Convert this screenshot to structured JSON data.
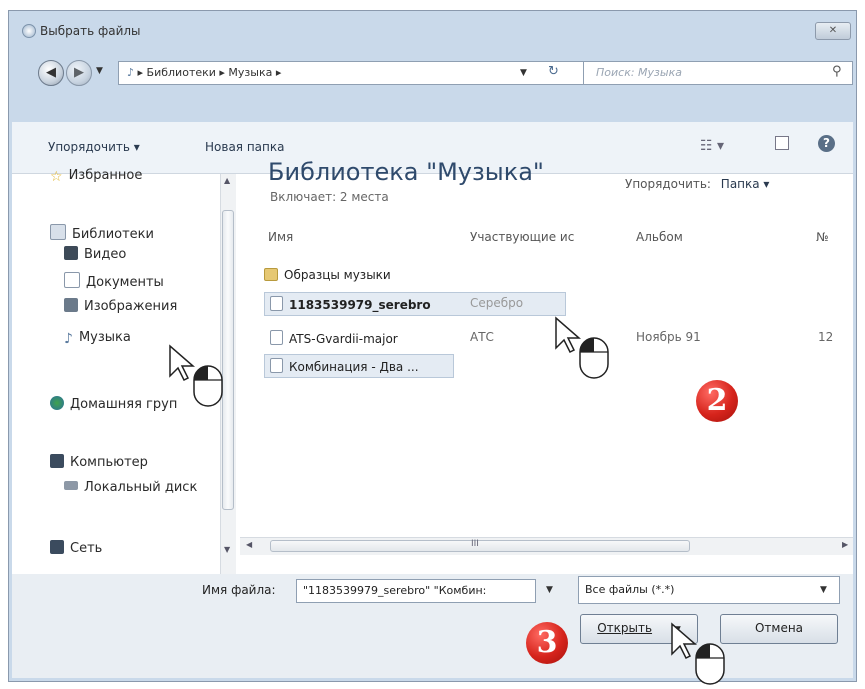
{
  "window": {
    "title": "Выбрать файлы",
    "close_icon": "close-icon"
  },
  "address": {
    "crumbs": "▸ Библиотеки ▸ Музыка ▸",
    "search_placeholder": "Поиск: Музыка"
  },
  "toolbar": {
    "organize": "Упорядочить ▾",
    "new_folder": "Новая папка"
  },
  "sidebar": {
    "favorites": "Избранное",
    "libraries": "Библиотеки",
    "video": "Видео",
    "documents": "Документы",
    "images": "Изображения",
    "music": "Музыка",
    "homegroup": "Домашняя груп",
    "computer": "Компьютер",
    "local_disk": "Локальный диск",
    "network": "Сеть"
  },
  "library": {
    "title": "Библиотека \"Музыка\"",
    "subtitle": "Включает: 2 места",
    "arrange_label": "Упорядочить:",
    "arrange_value": "Папка ▾"
  },
  "columns": {
    "name": "Имя",
    "artists": "Участвующие ис",
    "album": "Альбом",
    "number": "№"
  },
  "files": [
    {
      "name": "Образцы музыки",
      "artist": "",
      "album": "",
      "number": ""
    },
    {
      "name": "1183539979_serebro",
      "artist": "Серебро",
      "album": "",
      "number": ""
    },
    {
      "name": "ATS-Gvardii-major",
      "artist": "АТС",
      "album": "Ноябрь 91",
      "number": "12"
    },
    {
      "name": "Комбинация - Два ...",
      "artist": "",
      "album": "",
      "number": ""
    }
  ],
  "hscroll_label": "III",
  "bottom": {
    "filename_label": "Имя файла:",
    "filename_value": "\"1183539979_serebro\" \"Комбин:",
    "filetype_value": "Все файлы (*.*)",
    "open_button": "Открыть",
    "cancel_button": "Отмена"
  },
  "badges": {
    "step2": "2",
    "step3": "3"
  },
  "colors": {
    "accent_red": "#d6241c",
    "selection": "#e4ebf3",
    "title_blue": "#2f4a6c"
  }
}
